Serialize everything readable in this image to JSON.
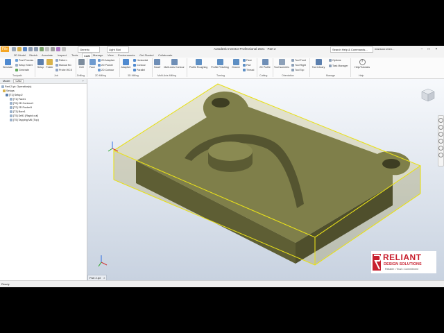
{
  "title_bar": {
    "file_label": "File",
    "material_combo": "Generic",
    "appearance_combo": "Light Slat",
    "app_title": "Autodesk Inventor Professional 2021 · Part 2",
    "search_placeholder": "Search Help & Commands...",
    "user_label": "mansoor.zhen...",
    "minimize": "–",
    "maximize": "□",
    "close": "×"
  },
  "tabs": [
    "3D Model",
    "Sketch",
    "Annotate",
    "Inspect",
    "Tools",
    "CAM",
    "Manage",
    "View",
    "Environments",
    "Get Started",
    "Collaborate"
  ],
  "active_tab": "CAM",
  "ribbon": {
    "toolpath": {
      "simulate": "Simulate",
      "post_process": "Post Process",
      "setup_sheet": "Setup Sheet",
      "generate": "Generate",
      "group": "Toolpath"
    },
    "job": {
      "setup": "Setup",
      "folder": "Folder",
      "pattern": "Pattern",
      "manual_nc": "Manual NC",
      "probe_wcs": "Probe WCS",
      "group": "Job"
    },
    "drilling": {
      "drill": "Drill",
      "group": "Drilling"
    },
    "milling2d": {
      "face": "Face",
      "adaptive2d": "2D Adaptive",
      "pocket2d": "2D Pocket",
      "contour2d": "2D Contour",
      "group": "2D Milling"
    },
    "milling3d": {
      "adaptive": "Adaptive",
      "horizontal": "Horizontal",
      "contour": "Contour",
      "parallel": "Parallel",
      "group": "3D Milling"
    },
    "multiaxis": {
      "swarf": "Swarf",
      "multi_axis_contour": "Multi-Axis Contour",
      "group": "Multi-Axis Milling"
    },
    "turning": {
      "profile_roughing": "Profile Roughing",
      "profile_finishing": "Profile Finishing",
      "groove": "Groove",
      "face": "Face",
      "part": "Part",
      "thread": "Thread",
      "group": "Turning"
    },
    "cutting": {
      "profile2d": "2D Profile",
      "group": "Cutting"
    },
    "orientation": {
      "tool_isometric": "Tool Isometric",
      "tool_front": "Tool Front",
      "tool_right": "Tool Right",
      "tool_top": "Tool Top",
      "group": "Orientation"
    },
    "manage": {
      "tool_library": "Tool Library",
      "options": "Options",
      "task_manager": "Task Manager",
      "group": "Manage"
    },
    "help": {
      "help_tutorials": "Help/Tutorials",
      "group": "Help"
    }
  },
  "browser": {
    "tabs": [
      "Model",
      "CAM"
    ],
    "active_tab": "CAM",
    "tree": [
      "Part 2.ipt: Operation(s)",
      "Setups",
      "[T1] Setup2",
      "[T1] Face1",
      "[T6] 2D Contour1",
      "[T2] 2D Pocket1",
      "[T3] Bore1",
      "[T5] Drill1 [Rapid out]",
      "[T5] Tapping M6 (Top)"
    ]
  },
  "document_tab": "Part 2.ipt",
  "status_text": "Ready",
  "colors": {
    "part_fill": "#6b6b3c",
    "part_top": "#8d8d57",
    "stock_box": "#e8e01a",
    "accent": "#f5a623",
    "logo_red": "#c8202f"
  },
  "logo": {
    "name": "RELIANT",
    "sub": "DESIGN SOLUTIONS",
    "tagline": "Reliable • Trust • Commitment"
  }
}
